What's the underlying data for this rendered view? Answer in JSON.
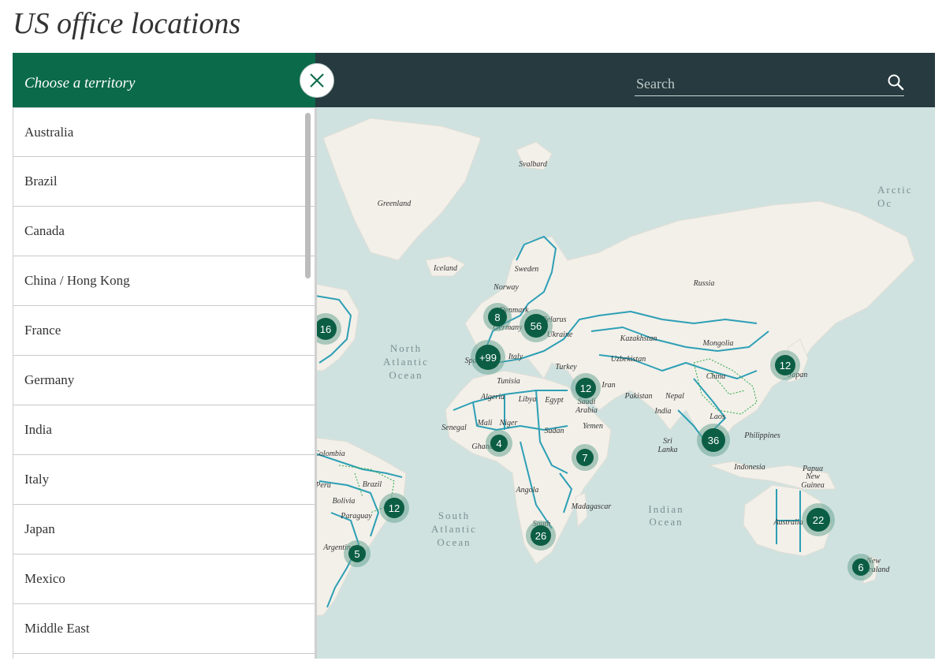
{
  "page": {
    "title": "US office locations"
  },
  "panel": {
    "title": "Choose a territory",
    "close_icon": "close-icon",
    "territories": [
      "Australia",
      "Brazil",
      "Canada",
      "China / Hong Kong",
      "France",
      "Germany",
      "India",
      "Italy",
      "Japan",
      "Mexico",
      "Middle East"
    ]
  },
  "search": {
    "placeholder": "Search",
    "icon": "search-icon"
  },
  "zoom": {
    "in_label": "+",
    "out_label": "-",
    "locate_icon": "locate-icon"
  },
  "map": {
    "oceans": [
      {
        "id": "north-atlantic",
        "lines": [
          "North",
          "Atlantic",
          "Ocean"
        ]
      },
      {
        "id": "south-atlantic",
        "lines": [
          "South",
          "Atlantic",
          "Ocean"
        ]
      },
      {
        "id": "indian",
        "lines": [
          "Indian",
          "Ocean"
        ]
      },
      {
        "id": "arctic",
        "lines": [
          "Arctic",
          "Oc"
        ]
      }
    ],
    "labels": [
      "Svalbard",
      "Greenland",
      "Iceland",
      "Sweden",
      "Norway",
      "Russia",
      "Denmark",
      "Germany",
      "Belarus",
      "Ukraine",
      "Spain",
      "Italy",
      "Kazakhstan",
      "Mongolia",
      "Turkey",
      "Uzbekistan",
      "China",
      "Japan",
      "Tunisia",
      "Iran",
      "Algeria",
      "Libya",
      "Egypt",
      "Saudi",
      "Arabia",
      "Pakistan",
      "Nepal",
      "India",
      "Mali",
      "Niger",
      "Senegal",
      "Yemen",
      "Sudan",
      "Ghana",
      "Laos",
      "Philippines",
      "Sri",
      "Lanka",
      "Indonesia",
      "Papua",
      "New",
      "Guinea",
      "Angola",
      "Madagascar",
      "South",
      "Australia",
      "New",
      "Zealand",
      "Colombia",
      "Peru",
      "Brazil",
      "Bolivia",
      "Paraguay",
      "Argentina"
    ],
    "clusters": [
      {
        "id": "north-america",
        "count": "16"
      },
      {
        "id": "uk",
        "count": "8"
      },
      {
        "id": "central-europe",
        "count": "56"
      },
      {
        "id": "western-europe",
        "count": "+99"
      },
      {
        "id": "middle-east",
        "count": "12"
      },
      {
        "id": "west-africa",
        "count": "4"
      },
      {
        "id": "east-africa",
        "count": "7"
      },
      {
        "id": "south-africa",
        "count": "26"
      },
      {
        "id": "brazil",
        "count": "12"
      },
      {
        "id": "argentina",
        "count": "5"
      },
      {
        "id": "southeast-asia",
        "count": "36"
      },
      {
        "id": "japan",
        "count": "12"
      },
      {
        "id": "australia",
        "count": "22"
      },
      {
        "id": "new-zealand",
        "count": "6"
      }
    ]
  },
  "colors": {
    "panel_header": "#0b6a4a",
    "topbar": "#263a3f",
    "cluster": "#0b5e43",
    "cluster_ring": "#6da596",
    "border": "#2d9fb5",
    "water": "#cfe2e0",
    "land": "#f2f0e9"
  }
}
